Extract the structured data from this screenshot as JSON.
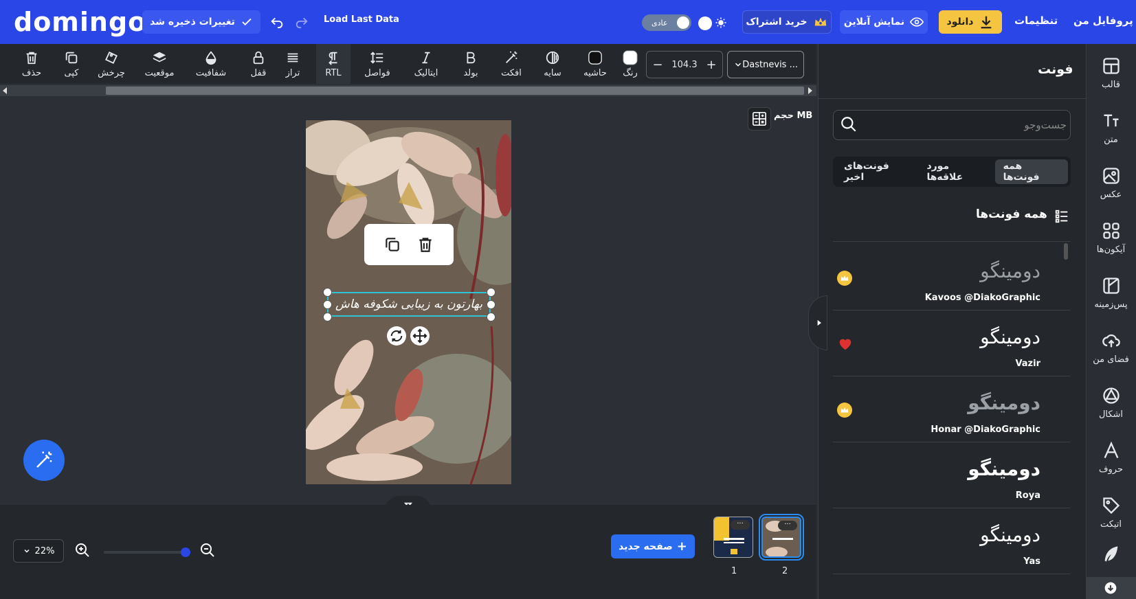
{
  "header": {
    "logo": "domingo",
    "saved_label": "تغییرات ذخیره شد",
    "load_last": "Load Last Data",
    "theme_label": "عادی",
    "subscribe_label": "خرید اشتراک",
    "preview_label": "نمایش آنلاین",
    "download_label": "دانلود",
    "settings_label": "تنظیمات",
    "profile_label": "پروفایل من",
    "accent_color": "#2a46e6",
    "download_color": "#f5c542"
  },
  "toolbar": {
    "font_name": "Dastnevis ...",
    "font_size": "104.3",
    "tools": {
      "delete": "حذف",
      "copy": "کپی",
      "rotate": "چرخش",
      "position": "موقعیت",
      "opacity": "شفافیت",
      "lock": "قفل",
      "align": "تراز",
      "rtl": "RTL",
      "spacing": "فواصل",
      "italic": "ایتالیک",
      "bold": "بولد",
      "effect": "افکت",
      "shadow": "سایه",
      "border": "حاشیه",
      "color": "رنگ"
    }
  },
  "canvas": {
    "size_label": "حجم MB",
    "selected_text": "بهارتون به زیبایی شکوفه هاش",
    "selection_color": "#2ec4d6"
  },
  "bottom": {
    "zoom_value": "22%",
    "zoom_level": 0.22,
    "new_page_label": "صفحه جدید",
    "pages": [
      {
        "number": "1",
        "thumb_text": "..."
      },
      {
        "number": "2",
        "thumb_text": "..."
      }
    ]
  },
  "panel": {
    "title": "فونت",
    "search_placeholder": "جست‌وجو",
    "tabs": [
      "همه فونت‌ها",
      "مورد علاقه‌ها",
      "فونت‌های اخیر"
    ],
    "section_title": "همه فونت‌ها",
    "fonts": [
      {
        "sample": "دومینگو",
        "name": "Kavoos @DiakoGraphic",
        "marker": "premium"
      },
      {
        "sample": "دومینگو",
        "name": "Vazir",
        "marker": "favorite"
      },
      {
        "sample": "دومینگو",
        "name": "Honar @DiakoGraphic",
        "marker": "premium"
      },
      {
        "sample": "دومینگو",
        "name": "Roya",
        "marker": "none"
      },
      {
        "sample": "دومینگو",
        "name": "Yas",
        "marker": "none"
      }
    ]
  },
  "sidebar": {
    "items": [
      {
        "label": "قالب",
        "icon": "template-icon"
      },
      {
        "label": "متن",
        "icon": "text-icon"
      },
      {
        "label": "عکس",
        "icon": "image-icon"
      },
      {
        "label": "آیکون‌ها",
        "icon": "icons-grid-icon"
      },
      {
        "label": "پس‌زمینه",
        "icon": "background-icon"
      },
      {
        "label": "فضای من",
        "icon": "cloud-upload-icon"
      },
      {
        "label": "اشکال",
        "icon": "shapes-icon"
      },
      {
        "label": "حروف",
        "icon": "letters-icon"
      },
      {
        "label": "اتیکت",
        "icon": "tag-icon"
      }
    ]
  }
}
